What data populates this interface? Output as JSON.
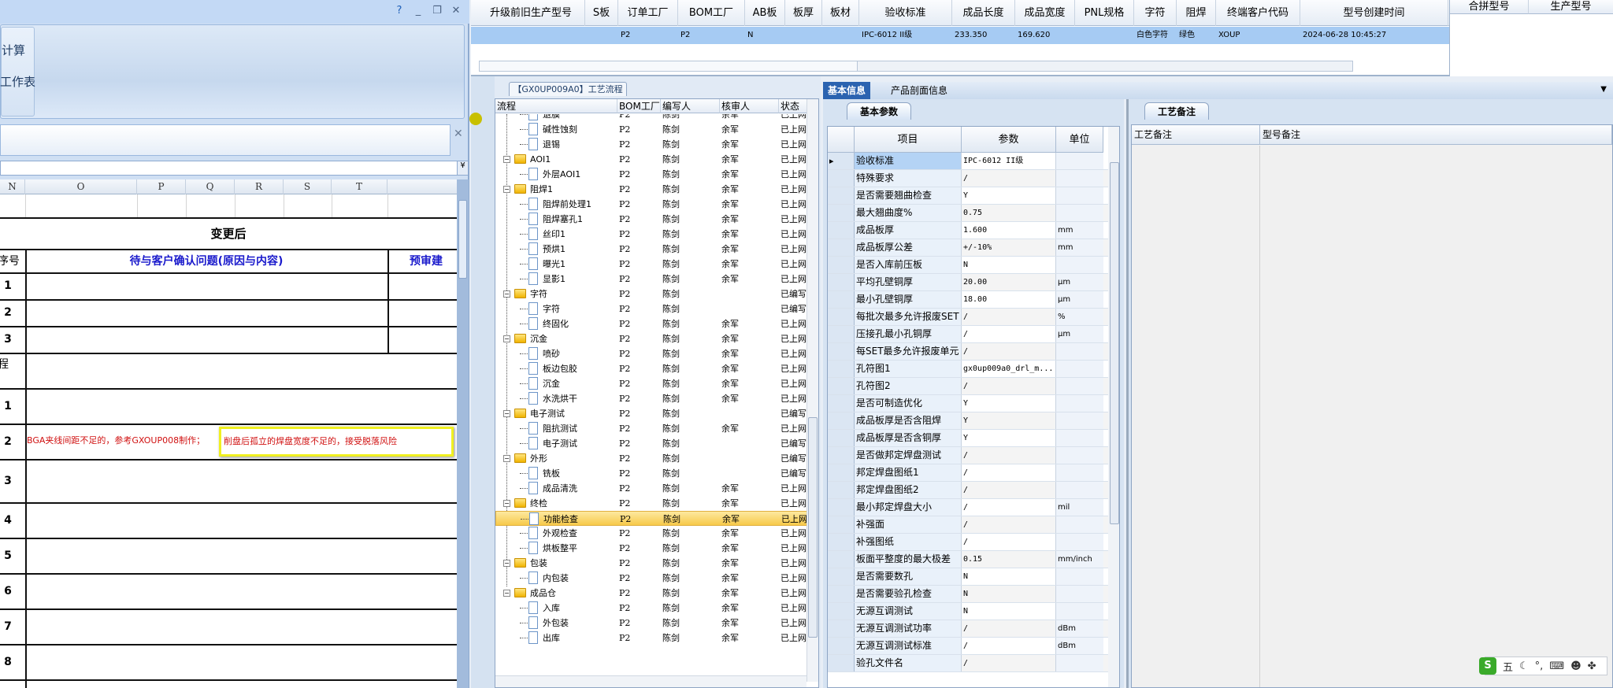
{
  "excel": {
    "ribbon_buttons": [
      "计算",
      "工作表"
    ],
    "column_headers": [
      "N",
      "O",
      "P",
      "Q",
      "R",
      "S",
      "T"
    ],
    "section_title": "变更后",
    "table_header": {
      "seq": "序号",
      "issue": "待与客户确认问题(原因与内容)",
      "advice": "预审建"
    },
    "rows_a": [
      "1",
      "2",
      "3"
    ],
    "process_label": "程",
    "rows_b": [
      {
        "seq": "1",
        "text": ""
      },
      {
        "seq": "2",
        "text": "BGA夹线间距不足的，参考GXOUP008制作；",
        "highlight": "削盘后孤立的焊盘宽度不足的，接受脱落风险"
      },
      {
        "seq": "3",
        "text": ""
      },
      {
        "seq": "4",
        "text": ""
      },
      {
        "seq": "5",
        "text": ""
      },
      {
        "seq": "6",
        "text": ""
      },
      {
        "seq": "7",
        "text": ""
      },
      {
        "seq": "8",
        "text": ""
      }
    ],
    "colors": {
      "header_text": "#1a1acc",
      "note_text": "#d01010",
      "highlight_border": "#f0f020"
    }
  },
  "top_grid": {
    "columns": [
      "升级前旧生产型号",
      "S板",
      "订单工厂",
      "BOM工厂",
      "AB板",
      "板厚",
      "板材",
      "验收标准",
      "成品长度",
      "成品宽度",
      "PNL规格",
      "字符",
      "阻焊",
      "终端客户代码",
      "型号创建时间"
    ],
    "row": [
      "",
      "",
      "P2",
      "P2",
      "N",
      "",
      "",
      "IPC-6012 II级",
      "233.350",
      "169.620",
      "",
      "白色字符",
      "绿色",
      "XOUP",
      "2024-06-28 10:45:27"
    ],
    "right_columns": [
      "合拼型号",
      "生产型号"
    ]
  },
  "process": {
    "tab": "【GX0UP009A0】工艺流程",
    "columns": [
      "流程",
      "BOM工厂",
      "编写人",
      "核审人",
      "状态"
    ],
    "selected_index": 27,
    "rows": [
      {
        "l": 1,
        "n": "退膜",
        "b": "P2",
        "w": "陈剑",
        "r": "余军",
        "s": "已上网"
      },
      {
        "l": 1,
        "n": "碱性蚀刻",
        "b": "P2",
        "w": "陈剑",
        "r": "余军",
        "s": "已上网"
      },
      {
        "l": 1,
        "n": "退锡",
        "b": "P2",
        "w": "陈剑",
        "r": "余军",
        "s": "已上网"
      },
      {
        "l": 0,
        "n": "AOI1",
        "b": "P2",
        "w": "陈剑",
        "r": "余军",
        "s": "已上网"
      },
      {
        "l": 1,
        "n": "外层AOI1",
        "b": "P2",
        "w": "陈剑",
        "r": "余军",
        "s": "已上网"
      },
      {
        "l": 0,
        "n": "阻焊1",
        "b": "P2",
        "w": "陈剑",
        "r": "余军",
        "s": "已上网"
      },
      {
        "l": 1,
        "n": "阻焊前处理1",
        "b": "P2",
        "w": "陈剑",
        "r": "余军",
        "s": "已上网"
      },
      {
        "l": 1,
        "n": "阻焊塞孔1",
        "b": "P2",
        "w": "陈剑",
        "r": "余军",
        "s": "已上网"
      },
      {
        "l": 1,
        "n": "丝印1",
        "b": "P2",
        "w": "陈剑",
        "r": "余军",
        "s": "已上网"
      },
      {
        "l": 1,
        "n": "预烘1",
        "b": "P2",
        "w": "陈剑",
        "r": "余军",
        "s": "已上网"
      },
      {
        "l": 1,
        "n": "曝光1",
        "b": "P2",
        "w": "陈剑",
        "r": "余军",
        "s": "已上网"
      },
      {
        "l": 1,
        "n": "显影1",
        "b": "P2",
        "w": "陈剑",
        "r": "余军",
        "s": "已上网"
      },
      {
        "l": 0,
        "n": "字符",
        "b": "P2",
        "w": "陈剑",
        "r": "",
        "s": "已编写"
      },
      {
        "l": 1,
        "n": "字符",
        "b": "P2",
        "w": "陈剑",
        "r": "",
        "s": "已编写"
      },
      {
        "l": 1,
        "n": "终固化",
        "b": "P2",
        "w": "陈剑",
        "r": "余军",
        "s": "已上网"
      },
      {
        "l": 0,
        "n": "沉金",
        "b": "P2",
        "w": "陈剑",
        "r": "余军",
        "s": "已上网"
      },
      {
        "l": 1,
        "n": "喷砂",
        "b": "P2",
        "w": "陈剑",
        "r": "余军",
        "s": "已上网"
      },
      {
        "l": 1,
        "n": "板边包胶",
        "b": "P2",
        "w": "陈剑",
        "r": "余军",
        "s": "已上网"
      },
      {
        "l": 1,
        "n": "沉金",
        "b": "P2",
        "w": "陈剑",
        "r": "余军",
        "s": "已上网"
      },
      {
        "l": 1,
        "n": "水洗烘干",
        "b": "P2",
        "w": "陈剑",
        "r": "余军",
        "s": "已上网"
      },
      {
        "l": 0,
        "n": "电子测试",
        "b": "P2",
        "w": "陈剑",
        "r": "",
        "s": "已编写"
      },
      {
        "l": 1,
        "n": "阻抗测试",
        "b": "P2",
        "w": "陈剑",
        "r": "余军",
        "s": "已上网"
      },
      {
        "l": 1,
        "n": "电子测试",
        "b": "P2",
        "w": "陈剑",
        "r": "",
        "s": "已编写"
      },
      {
        "l": 0,
        "n": "外形",
        "b": "P2",
        "w": "陈剑",
        "r": "",
        "s": "已编写"
      },
      {
        "l": 1,
        "n": "铣板",
        "b": "P2",
        "w": "陈剑",
        "r": "",
        "s": "已编写"
      },
      {
        "l": 1,
        "n": "成品清洗",
        "b": "P2",
        "w": "陈剑",
        "r": "余军",
        "s": "已上网"
      },
      {
        "l": 0,
        "n": "终检",
        "b": "P2",
        "w": "陈剑",
        "r": "余军",
        "s": "已上网"
      },
      {
        "l": 1,
        "n": "功能检查",
        "b": "P2",
        "w": "陈剑",
        "r": "余军",
        "s": "已上网"
      },
      {
        "l": 1,
        "n": "外观检查",
        "b": "P2",
        "w": "陈剑",
        "r": "余军",
        "s": "已上网"
      },
      {
        "l": 1,
        "n": "烘板整平",
        "b": "P2",
        "w": "陈剑",
        "r": "余军",
        "s": "已上网"
      },
      {
        "l": 0,
        "n": "包装",
        "b": "P2",
        "w": "陈剑",
        "r": "余军",
        "s": "已上网"
      },
      {
        "l": 1,
        "n": "内包装",
        "b": "P2",
        "w": "陈剑",
        "r": "余军",
        "s": "已上网"
      },
      {
        "l": 0,
        "n": "成品仓",
        "b": "P2",
        "w": "陈剑",
        "r": "余军",
        "s": "已上网"
      },
      {
        "l": 1,
        "n": "入库",
        "b": "P2",
        "w": "陈剑",
        "r": "余军",
        "s": "已上网"
      },
      {
        "l": 1,
        "n": "外包装",
        "b": "P2",
        "w": "陈剑",
        "r": "余军",
        "s": "已上网"
      },
      {
        "l": 1,
        "n": "出库",
        "b": "P2",
        "w": "陈剑",
        "r": "余军",
        "s": "已上网"
      }
    ]
  },
  "params": {
    "tabs": [
      "基本信息",
      "产品剖面信息"
    ],
    "subtab": "基本参数",
    "columns": [
      "项目",
      "参数",
      "单位"
    ],
    "rows": [
      [
        "验收标准",
        "IPC-6012 II级",
        ""
      ],
      [
        "特殊要求",
        "/",
        ""
      ],
      [
        "是否需要翘曲检查",
        "Y",
        ""
      ],
      [
        "最大翘曲度%",
        "0.75",
        ""
      ],
      [
        "成品板厚",
        "1.600",
        "mm"
      ],
      [
        "成品板厚公差",
        "+/-10%",
        "mm"
      ],
      [
        "是否入库前压板",
        "N",
        ""
      ],
      [
        "平均孔壁铜厚",
        "20.00",
        "μm"
      ],
      [
        "最小孔壁铜厚",
        "18.00",
        "μm"
      ],
      [
        "每批次最多允许报废SET",
        "/",
        "%"
      ],
      [
        "压接孔最小孔铜厚",
        "/",
        "μm"
      ],
      [
        "每SET最多允许报废单元",
        "/",
        ""
      ],
      [
        "孔符图1",
        "gx0up009a0_drl_m...",
        ""
      ],
      [
        "孔符图2",
        "/",
        ""
      ],
      [
        "是否可制造优化",
        "Y",
        ""
      ],
      [
        "成品板厚是否含阻焊",
        "Y",
        ""
      ],
      [
        "成品板厚是否含铜厚",
        "Y",
        ""
      ],
      [
        "是否做邦定焊盘测试",
        "/",
        ""
      ],
      [
        "邦定焊盘图纸1",
        "/",
        ""
      ],
      [
        "邦定焊盘图纸2",
        "/",
        ""
      ],
      [
        "最小邦定焊盘大小",
        "/",
        "mil"
      ],
      [
        "补强面",
        "/",
        ""
      ],
      [
        "补强图纸",
        "/",
        ""
      ],
      [
        "板面平整度的最大极差",
        "0.15",
        "mm/inch"
      ],
      [
        "是否需要数孔",
        "N",
        ""
      ],
      [
        "是否需要验孔检查",
        "N",
        ""
      ],
      [
        "无源互调测试",
        "N",
        ""
      ],
      [
        "无源互调测试功率",
        "/",
        "dBm"
      ],
      [
        "无源互调测试标准",
        "/",
        "dBm"
      ],
      [
        "验孔文件名",
        "/",
        ""
      ]
    ]
  },
  "notes": {
    "subtab": "工艺备注",
    "columns": [
      "工艺备注",
      "型号备注"
    ]
  },
  "ime": {
    "mode": "五",
    "icons": [
      "sogou-logo-icon",
      "moon-icon",
      "punctuation-icon",
      "keyboard-icon",
      "user-icon",
      "grid-icon"
    ]
  }
}
